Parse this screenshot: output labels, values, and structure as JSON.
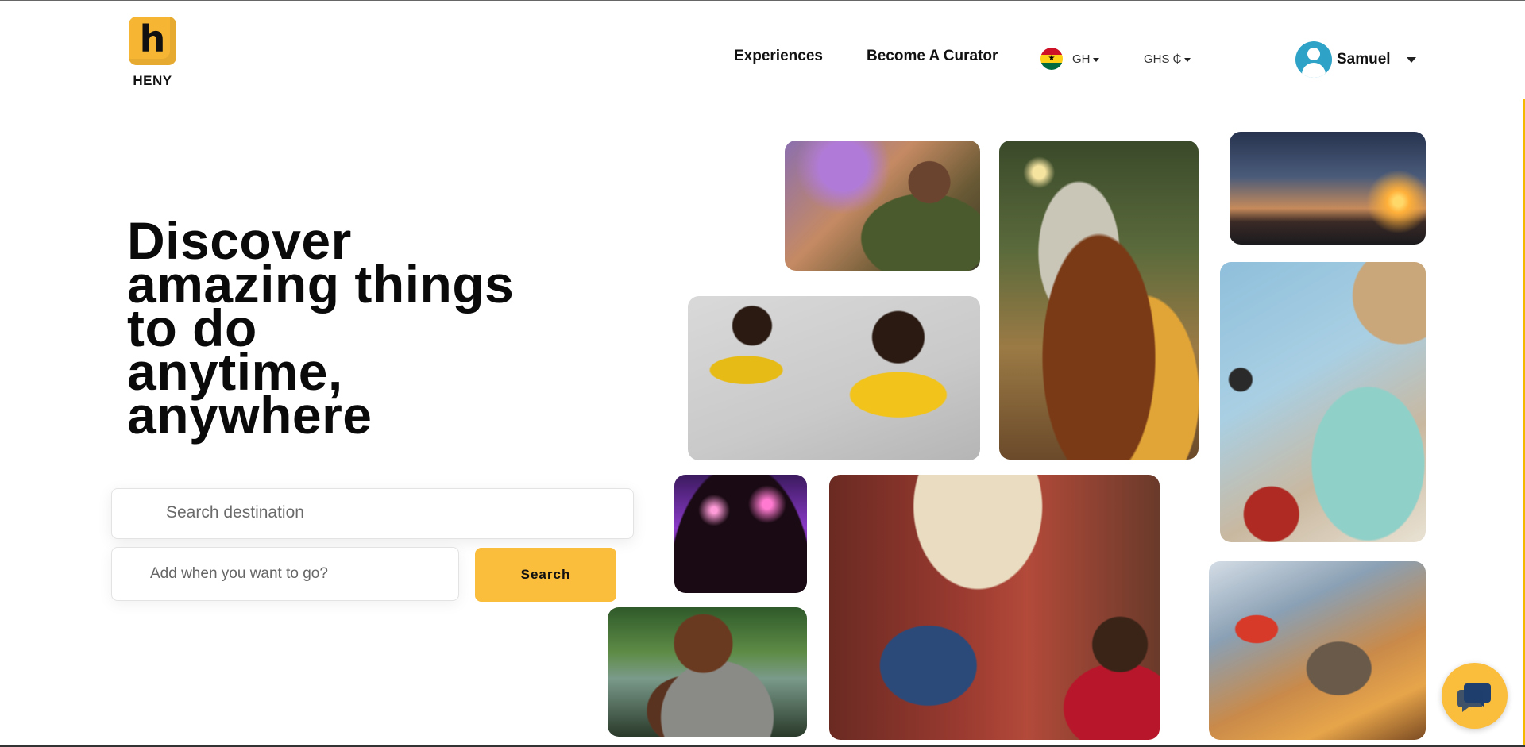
{
  "brand": {
    "logo_letter": "h",
    "name": "HENY",
    "accent": "#fbbd3c"
  },
  "nav": {
    "experiences": "Experiences",
    "become_curator": "Become A Curator",
    "country_code": "GH",
    "currency": "GHS ₵"
  },
  "user": {
    "name": "Samuel"
  },
  "hero": {
    "title_lines": [
      "Discover",
      "amazing things",
      "to do",
      "anytime,",
      "anywhere"
    ]
  },
  "search": {
    "destination_placeholder": "Search destination",
    "date_placeholder": "Add when you want to go?",
    "button_label": "Search"
  },
  "collage": [
    "image-woman-cooking",
    "image-burger-fries",
    "image-paragliding-sunset",
    "image-women-yellow-outfits",
    "image-travel-map-passport",
    "image-concert-fireworks",
    "image-painting-class",
    "image-paint-palette",
    "image-man-with-phone"
  ],
  "chat": {
    "icon": "chat-bubble-icon"
  }
}
